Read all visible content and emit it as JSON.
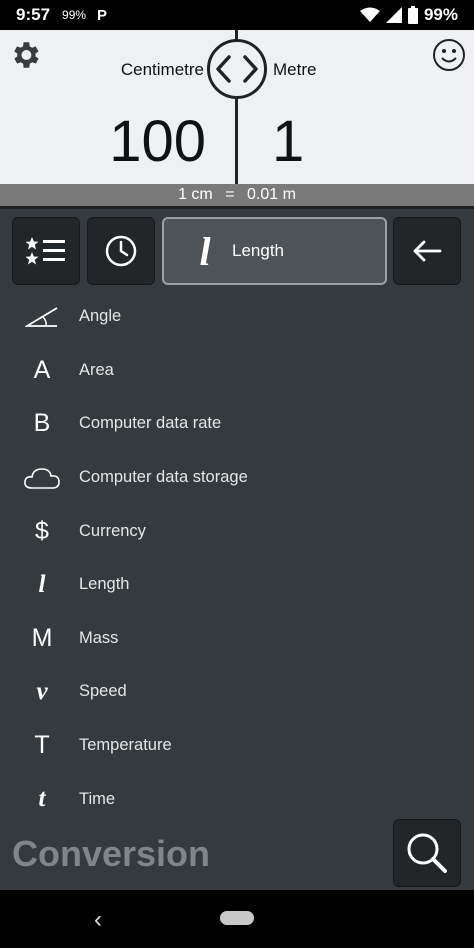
{
  "status_bar": {
    "time": "9:57",
    "small_text": "99%",
    "p_icon": "parking-icon",
    "battery": "99%"
  },
  "converter": {
    "from_unit": "Centimetre",
    "to_unit": "Metre",
    "from_value": "100",
    "to_value": "1",
    "equation": {
      "left": "1 cm",
      "op": "=",
      "right": "0.01 m"
    }
  },
  "toolbar": {
    "selected_category": "Length",
    "selected_icon_glyph": "l"
  },
  "categories": [
    {
      "label": "Angle",
      "glyph": "",
      "icon": "angle-icon"
    },
    {
      "label": "Area",
      "glyph": "A",
      "icon": "area-icon"
    },
    {
      "label": "Computer data rate",
      "glyph": "B",
      "icon": "data-rate-icon"
    },
    {
      "label": "Computer data storage",
      "glyph": "",
      "icon": "cloud-icon"
    },
    {
      "label": "Currency",
      "glyph": "$",
      "icon": "dollar-icon"
    },
    {
      "label": "Length",
      "glyph": "l",
      "icon": "length-icon"
    },
    {
      "label": "Mass",
      "glyph": "M",
      "icon": "mass-icon"
    },
    {
      "label": "Speed",
      "glyph": "v",
      "icon": "speed-icon"
    },
    {
      "label": "Temperature",
      "glyph": "T",
      "icon": "temperature-icon"
    },
    {
      "label": "Time",
      "glyph": "t",
      "icon": "time-icon"
    }
  ],
  "footer": {
    "title": "Conversion"
  },
  "nav": {
    "back_glyph": "‹"
  },
  "colors": {
    "top_panel_bg": "#eef1f4",
    "main_bg": "#343a3d",
    "button_bg": "#222628",
    "selected_button_bg": "#4d5356",
    "equation_bar_bg": "#7a7a7a"
  }
}
